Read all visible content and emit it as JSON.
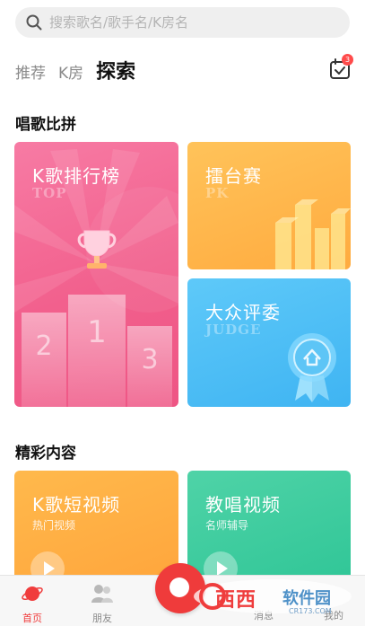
{
  "search": {
    "placeholder": "搜索歌名/歌手名/K房名"
  },
  "tabs": [
    {
      "label": "推荐",
      "active": false
    },
    {
      "label": "K房",
      "active": false
    },
    {
      "label": "探索",
      "active": true
    }
  ],
  "calendar_badge": "3",
  "sections": {
    "battle": "唱歌比拼",
    "featured": "精彩内容"
  },
  "cards": {
    "ranking": {
      "title": "K歌排行榜",
      "ghost": "TOP",
      "podium": [
        "2",
        "1",
        "3"
      ]
    },
    "arena": {
      "title": "擂台赛",
      "ghost": "PK"
    },
    "judge": {
      "title": "大众评委",
      "ghost": "JUDGE"
    },
    "short_video": {
      "title": "K歌短视频",
      "subtitle": "热门视频"
    },
    "teaching": {
      "title": "教唱视频",
      "subtitle": "名师辅导"
    }
  },
  "tabbar": [
    {
      "label": "首页",
      "active": true,
      "icon": "planet-icon"
    },
    {
      "label": "朋友",
      "active": false,
      "icon": "friends-icon"
    },
    {
      "label": "",
      "active": false,
      "icon": "sing-icon"
    },
    {
      "label": "消息",
      "active": false,
      "icon": "message-icon"
    },
    {
      "label": "我的",
      "active": false,
      "icon": "profile-icon"
    }
  ],
  "watermark": {
    "brand": "西西",
    "brand2": "软件园",
    "url": "CR173.COM"
  },
  "colors": {
    "accent": "#f03c3c",
    "ranking": "#f2608d",
    "arena": "#ffab3f",
    "judge": "#3fb4f2",
    "short_video": "#ffa43b",
    "teaching": "#2ec596"
  }
}
